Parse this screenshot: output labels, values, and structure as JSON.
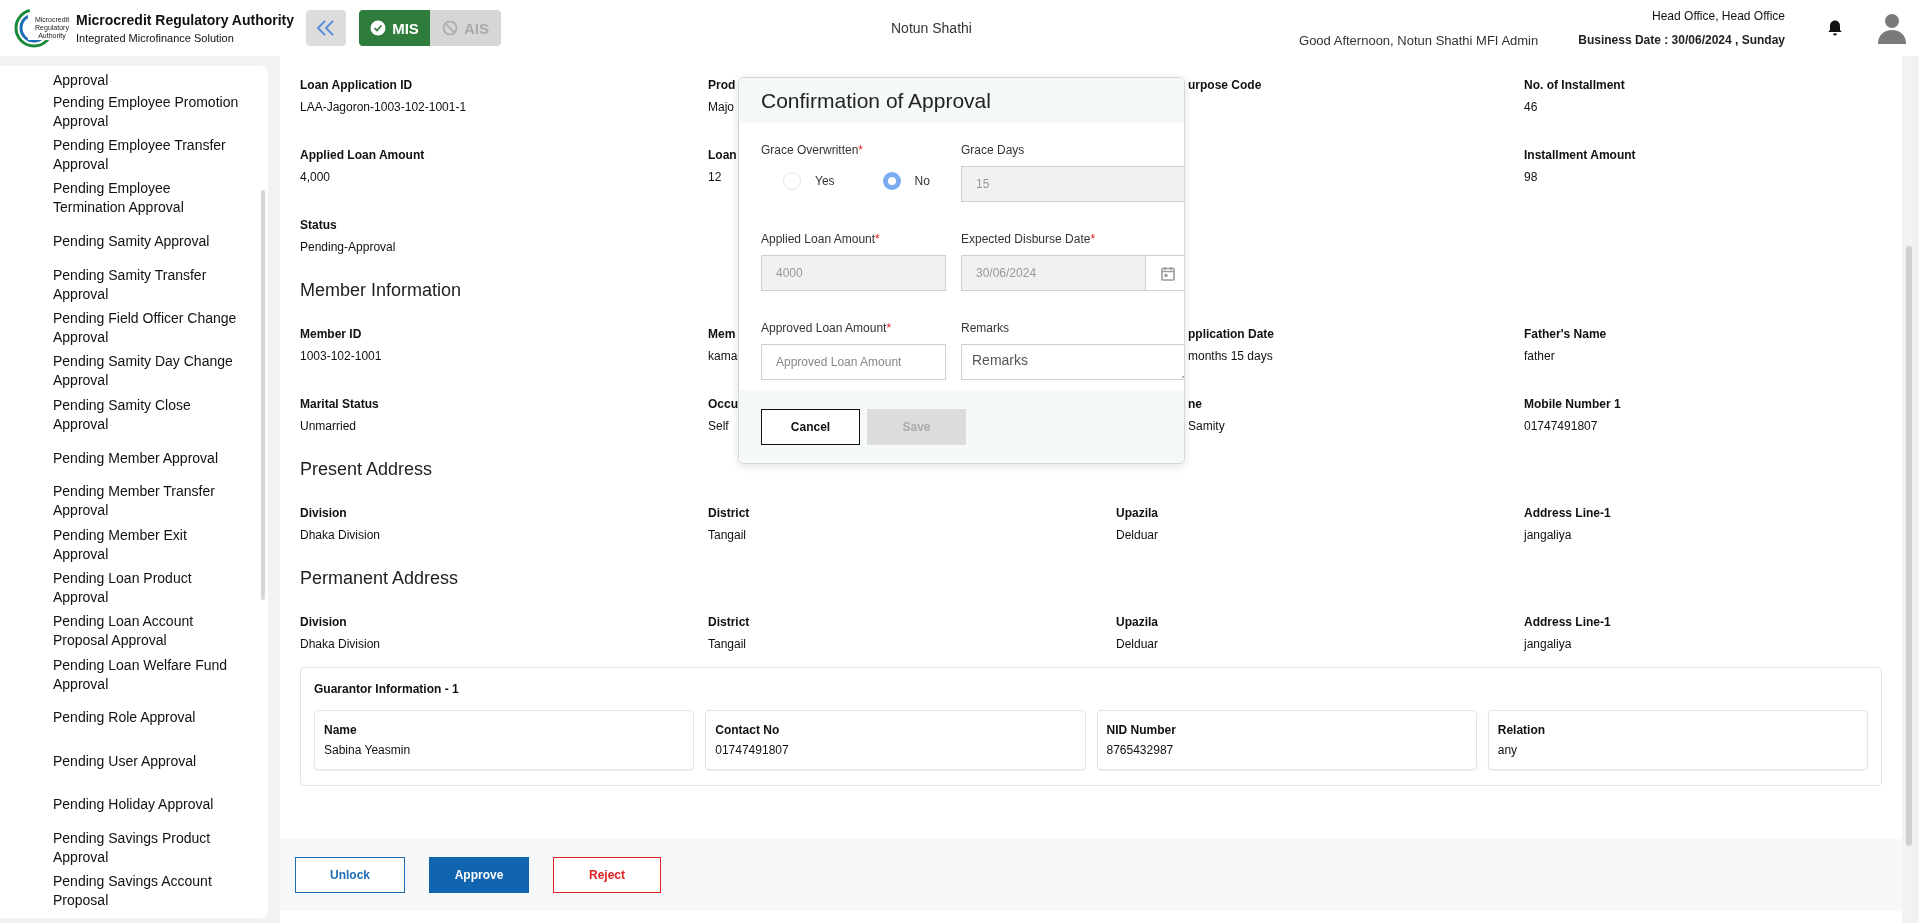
{
  "header": {
    "logo_text": "Microcredit Regulatory Authority",
    "title": "Microcredit Regulatory Authority",
    "subtitle": "Integrated Microfinance Solution",
    "modules": [
      {
        "label": "MIS",
        "kind": "check",
        "selected": true
      },
      {
        "label": "AIS",
        "kind": "ban",
        "selected": false
      }
    ],
    "organization": "Notun Shathi",
    "greeting": "Good Afternoon, Notun Shathi MFI Admin",
    "office": "Head Office, Head Office",
    "business_date": "Business Date : 30/06/2024 , Sunday"
  },
  "sidebar": {
    "items": [
      "Approval",
      "Pending Employee Promotion Approval",
      "Pending Employee Transfer Approval",
      "Pending Employee Termination Approval",
      "Pending Samity Approval",
      "Pending Samity Transfer Approval",
      "Pending Field Officer Change Approval",
      "Pending Samity Day Change Approval",
      "Pending Samity Close Approval",
      "Pending Member Approval",
      "Pending Member Transfer Approval",
      "Pending Member Exit Approval",
      "Pending Loan Product Approval",
      "Pending Loan Account Proposal Approval",
      "Pending Loan Welfare Fund Approval",
      "Pending Role Approval",
      "Pending User Approval",
      "Pending Holiday Approval",
      "Pending Savings Product Approval",
      "Pending Savings Account Proposal"
    ]
  },
  "blocks": [
    {
      "kind": "grid",
      "rows": [
        [
          {
            "label": "Loan Application ID",
            "value": "LAA-Jagoron-1003-102-1001-1"
          },
          {
            "label": "Prod",
            "value": "Majo"
          },
          {
            "label": "urpose Code",
            "after_overlay": true
          },
          {
            "label": "No. of Installment",
            "value": "46"
          }
        ],
        [
          {
            "label": "Applied Loan Amount",
            "value": "4,000"
          },
          {
            "label": "Loan",
            "value": "12"
          },
          null,
          {
            "label": "Installment Amount",
            "value": "98"
          }
        ],
        [
          {
            "label": "Status",
            "value": "Pending-Approval"
          },
          null,
          null,
          null
        ]
      ]
    },
    {
      "kind": "heading",
      "title": "Member Information"
    },
    {
      "kind": "grid",
      "rows": [
        [
          {
            "label": "Member ID",
            "value": "1003-102-1001"
          },
          {
            "label": "Mem",
            "value": "kama"
          },
          {
            "label": "pplication Date",
            "value": "months 15 days",
            "after_overlay": true
          },
          {
            "label": "Father's Name",
            "value": "father"
          }
        ],
        [
          {
            "label": "Marital Status",
            "value": "Unmarried"
          },
          {
            "label": "Occu",
            "value": "Self"
          },
          {
            "label": "ne",
            "value": "Samity",
            "after_overlay": true
          },
          {
            "label": "Mobile Number 1",
            "value": "01747491807"
          }
        ]
      ]
    },
    {
      "kind": "heading",
      "title": "Present Address"
    },
    {
      "kind": "grid",
      "rows": [
        [
          {
            "label": "Division",
            "value": "Dhaka Division"
          },
          {
            "label": "District",
            "value": "Tangail"
          },
          {
            "label": "Upazila",
            "value": "Delduar"
          },
          {
            "label": "Address Line-1",
            "value": "jangaliya"
          }
        ]
      ]
    },
    {
      "kind": "heading",
      "title": "Permanent Address"
    },
    {
      "kind": "grid",
      "rows": [
        [
          {
            "label": "Division",
            "value": "Dhaka Division"
          },
          {
            "label": "District",
            "value": "Tangail"
          },
          {
            "label": "Upazila",
            "value": "Delduar"
          },
          {
            "label": "Address Line-1",
            "value": "jangaliya"
          }
        ]
      ]
    }
  ],
  "guarantor": {
    "title": "Guarantor Information - 1",
    "fields": [
      {
        "label": "Name",
        "value": "Sabina Yeasmin"
      },
      {
        "label": "Contact No",
        "value": "01747491807"
      },
      {
        "label": "NID Number",
        "value": "8765432987"
      },
      {
        "label": "Relation",
        "value": "any"
      }
    ]
  },
  "actions": [
    {
      "label": "Unlock",
      "kind": "outline"
    },
    {
      "label": "Approve",
      "kind": "primary"
    },
    {
      "label": "Reject",
      "kind": "danger"
    }
  ],
  "modal": {
    "title": "Confirmation of Approval",
    "grace_overwritten": {
      "label": "Grace Overwritten",
      "required_mark": "*",
      "options": [
        {
          "label": "Yes",
          "selected": false
        },
        {
          "label": "No",
          "selected": true
        }
      ]
    },
    "fields": [
      {
        "label": "Grace Days",
        "kind": "text",
        "value": "15",
        "disabled": true
      },
      {
        "label": "Applied Loan Amount",
        "required_mark": "*",
        "kind": "text",
        "value": "4000",
        "disabled": true
      },
      {
        "label": "Expected Disburse Date",
        "required_mark": "*",
        "kind": "date",
        "value": "30/06/2024",
        "disabled": true
      },
      {
        "label": "Approved Loan Amount",
        "required_mark": "*",
        "kind": "text",
        "placeholder": "Approved Loan Amount",
        "disabled": false
      },
      {
        "label": "Remarks",
        "kind": "textarea",
        "placeholder": "Remarks",
        "disabled": false
      }
    ],
    "buttons": [
      {
        "label": "Cancel",
        "disabled": false
      },
      {
        "label": "Save",
        "disabled": true
      }
    ]
  }
}
